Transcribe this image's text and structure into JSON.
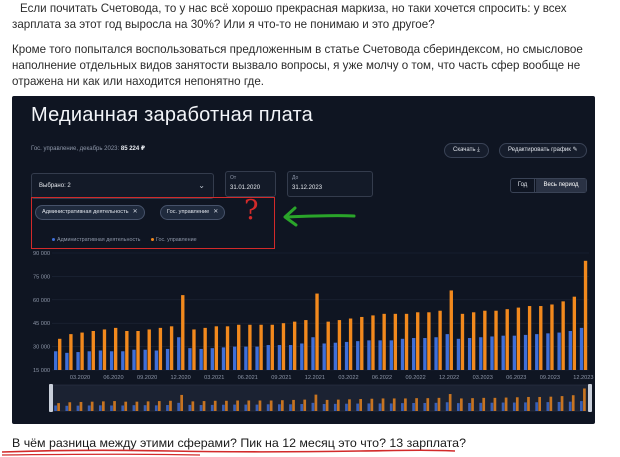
{
  "text": {
    "p1": "Если почитать Счетовода, то у нас всё хорошо прекрасная маркиза, но таки хочется спросить: у всех зарплата  за этот год выросла на 30%? Или я что-то не понимаю и это другое?",
    "p2": "Кроме того попытался воспользоваться предложенным в статье Счетовода сбериндексом, но смысловое наполнение отдельных видов занятости вызвало вопросы, я уже молчу о том, что часть сфер вообще не отражена ни как или находится непонятно где.",
    "caption": "В чём разница между этими сферами? Пик на 12 месяц это что? 13 зарплата?"
  },
  "panel": {
    "title": "Медианная заработная плата",
    "sub_label": "Гос. управление, декабрь 2023:",
    "sub_value": "85 224 ₽",
    "download_label": "Скачать",
    "edit_label": "Редактировать график",
    "select_value": "Выбрано: 2",
    "from_label": "От",
    "from_value": "31.01.2020",
    "to_label": "До",
    "to_value": "31.12.2023",
    "toggle_year": "Год",
    "toggle_all": "Весь период",
    "tag1": "Административная деятельность",
    "tag2": "Гос. управление",
    "tag_close": "✕"
  },
  "annotation": {
    "question": "?"
  },
  "colors": {
    "series_blue": "#3f6fd8",
    "series_orange": "#f2891d",
    "annotation_red": "#d22a2a",
    "annotation_green": "#2aa52a",
    "panel_bg": "#0f1522"
  },
  "chart_data": {
    "type": "bar",
    "x_ticks": [
      "03.2020",
      "06.2020",
      "09.2020",
      "12.2020",
      "03.2021",
      "06.2021",
      "09.2021",
      "12.2021",
      "03.2022",
      "06.2022",
      "09.2022",
      "12.2022",
      "03.2023",
      "06.2023",
      "09.2023",
      "12.2023"
    ],
    "y_ticks": [
      "15 000",
      "30 000",
      "45 000",
      "60 000",
      "75 000",
      "90 000"
    ],
    "ylim": [
      15000,
      90000
    ],
    "series": [
      {
        "name": "Административная деятельность",
        "color": "#3f6fd8",
        "values": [
          27000,
          26000,
          26500,
          27000,
          27500,
          27000,
          27000,
          28000,
          28000,
          27500,
          28500,
          36000,
          29000,
          28500,
          29000,
          29500,
          30000,
          30000,
          30000,
          31000,
          31000,
          31000,
          32000,
          36000,
          32000,
          32500,
          33000,
          33500,
          34000,
          34000,
          34000,
          35000,
          35500,
          35500,
          36000,
          38000,
          35000,
          35500,
          36000,
          36500,
          37000,
          37000,
          37500,
          38000,
          38500,
          39000,
          40000,
          42000
        ]
      },
      {
        "name": "Гос. управление",
        "color": "#f2891d",
        "values": [
          35000,
          38000,
          39000,
          40000,
          41000,
          42000,
          40000,
          40000,
          41000,
          42000,
          43000,
          63000,
          41000,
          42000,
          43000,
          43000,
          44000,
          44000,
          44000,
          44000,
          45000,
          46000,
          47000,
          64000,
          46000,
          47000,
          48000,
          49000,
          50000,
          51000,
          51000,
          51000,
          52000,
          52000,
          53000,
          66000,
          51000,
          52000,
          53000,
          53000,
          54000,
          55000,
          56000,
          56000,
          57000,
          59000,
          62000,
          85000
        ]
      }
    ]
  }
}
